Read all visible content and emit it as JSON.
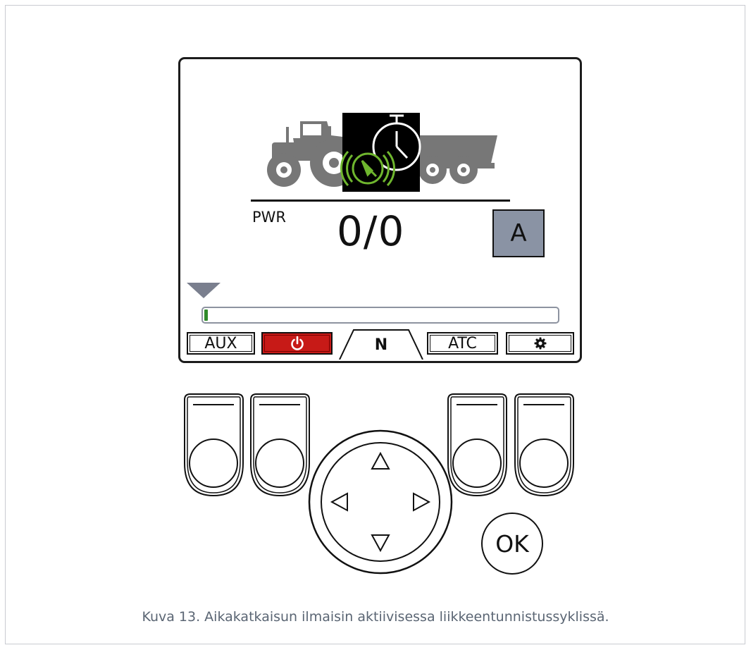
{
  "display": {
    "pwr_label": "PWR",
    "value": "0/0",
    "mode": "A",
    "progress_fraction": 0.01,
    "softkeys": [
      {
        "label": "AUX"
      },
      {
        "label": "",
        "icon": "power-icon",
        "color": "#c71a17"
      },
      {
        "label": "N",
        "selected": true
      },
      {
        "label": "ATC"
      },
      {
        "label": "",
        "icon": "gear-icon"
      }
    ]
  },
  "status_icons": [
    "tractor-icon",
    "trailer-icon",
    "timer-icon",
    "motion-sensor-icon"
  ],
  "keypad": {
    "ok_label": "OK",
    "arrows": [
      "arrow-up-icon",
      "arrow-left-icon",
      "arrow-right-icon",
      "arrow-down-icon"
    ]
  },
  "caption": "Kuva 13. Aikakatkaisun ilmaisin aktiivisessa liikkeentunnistussyklissä.",
  "colors": {
    "active_green": "#6fb62e",
    "power_red": "#c71a17",
    "mode_grey": "#8a93a4"
  }
}
